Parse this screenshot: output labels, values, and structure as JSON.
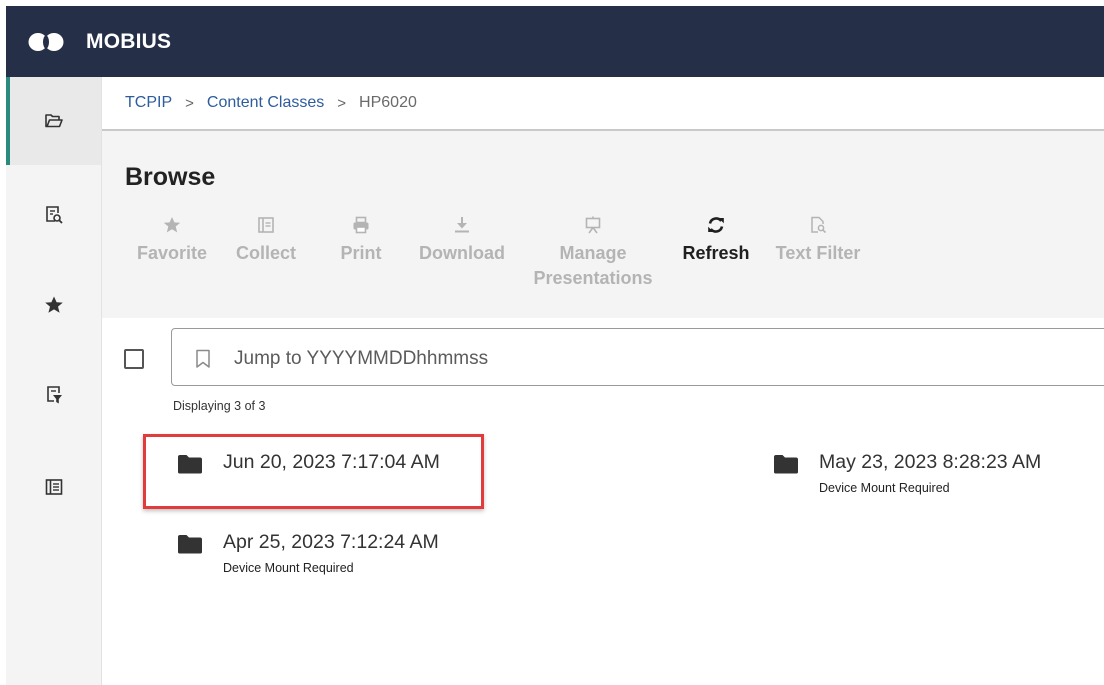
{
  "header": {
    "title": "MOBIUS",
    "logo_icon": "mobius-logo-icon"
  },
  "sidebar": {
    "items": [
      {
        "icon": "folder-open-icon",
        "active": true
      },
      {
        "icon": "document-search-icon",
        "active": false
      },
      {
        "icon": "star-icon",
        "active": false
      },
      {
        "icon": "filter-list-icon",
        "active": false
      },
      {
        "icon": "report-icon",
        "active": false
      }
    ]
  },
  "breadcrumb": {
    "items": [
      "TCPIP",
      "Content Classes",
      "HP6020"
    ],
    "separator": ">"
  },
  "browse": {
    "title": "Browse",
    "toolbar": {
      "favorite": "Favorite",
      "collect": "Collect",
      "print": "Print",
      "download": "Download",
      "manage_line1": "Manage",
      "manage_line2": "Presentations",
      "refresh": "Refresh",
      "text_filter": "Text Filter"
    }
  },
  "jump": {
    "placeholder": "Jump to YYYYMMDDhhmmss",
    "value": ""
  },
  "display_count": "Displaying 3 of 3",
  "results": [
    {
      "title": "Jun 20, 2023 7:17:04 AM",
      "subtitle": ""
    },
    {
      "title": "May 23, 2023 8:28:23 AM",
      "subtitle": "Device Mount Required"
    },
    {
      "title": "Apr 25, 2023 7:12:24 AM",
      "subtitle": "Device Mount Required"
    }
  ],
  "colors": {
    "header_bg": "#252f47",
    "active_accent": "#2a8a7e",
    "link": "#2e5c9c",
    "highlight": "#e23b3b",
    "disabled_text": "#b4b4b4"
  }
}
